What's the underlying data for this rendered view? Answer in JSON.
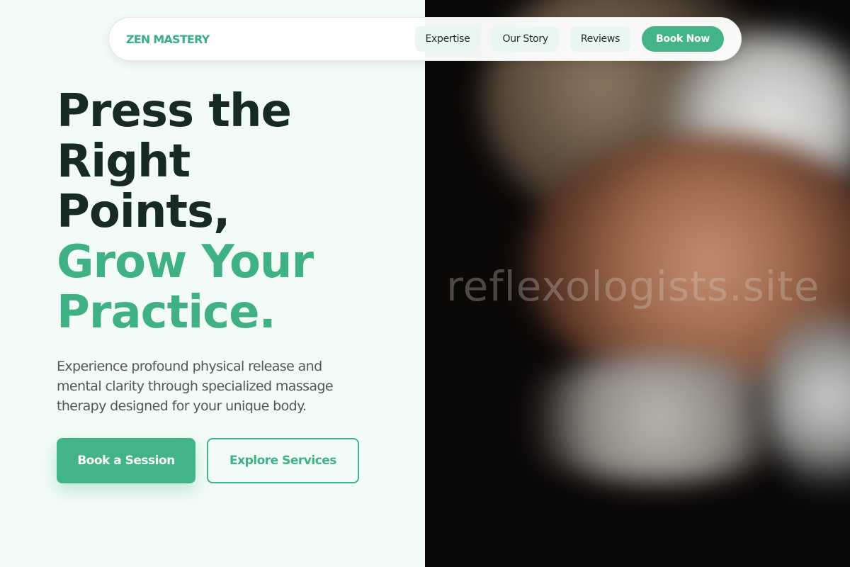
{
  "brand": {
    "name": "ZEN MASTERY",
    "color": "#3caf85"
  },
  "nav": {
    "items": [
      {
        "label": "Expertise"
      },
      {
        "label": "Our Story"
      },
      {
        "label": "Reviews"
      }
    ],
    "cta_label": "Book Now"
  },
  "hero": {
    "title_lines_dark": [
      "Press the",
      "Right",
      "Points,"
    ],
    "title_lines_green": [
      "Grow Your",
      "Practice."
    ],
    "subtitle": "Experience profound physical release and mental clarity through specialized massage therapy designed for your unique body.",
    "primary_button": "Book a Session",
    "secondary_button": "Explore Services"
  },
  "image": {
    "watermark": "reflexologists.site",
    "subject": "massage-back-photo"
  },
  "colors": {
    "accent": "#43b488",
    "heading_dark": "#172a24",
    "background": "#f2fbf7"
  }
}
